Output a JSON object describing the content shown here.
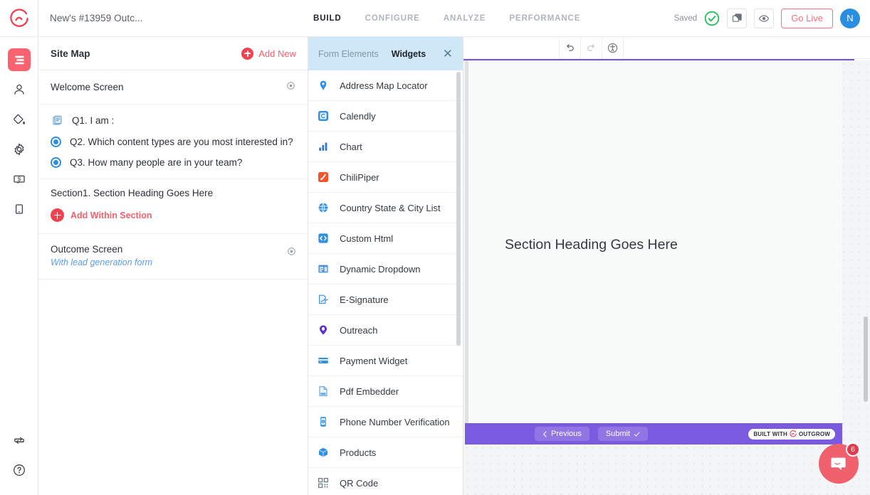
{
  "topbar": {
    "logo_icon": "outgrow-logo-icon",
    "doc_title": "New's #13959 Outc...",
    "tabs": [
      {
        "label": "BUILD",
        "active": true
      },
      {
        "label": "CONFIGURE",
        "active": false
      },
      {
        "label": "ANALYZE",
        "active": false
      },
      {
        "label": "PERFORMANCE",
        "active": false
      }
    ],
    "saved_label": "Saved",
    "saved_icon": "check-circle-icon",
    "clone_icon": "copy-icon",
    "preview_icon": "eye-icon",
    "go_live_label": "Go Live",
    "avatar_initial": "N",
    "accent_red": "#f4414f",
    "avatar_blue": "#2a8fe0",
    "go_live_border": "#f9707f"
  },
  "rail": {
    "items": [
      {
        "icon": "layout-layers-icon",
        "active": true
      },
      {
        "icon": "user-icon",
        "active": false
      },
      {
        "icon": "paint-bucket-icon",
        "active": false
      },
      {
        "icon": "gear-icon",
        "active": false
      },
      {
        "icon": "dollar-tag-icon",
        "active": false
      },
      {
        "icon": "mobile-device-icon",
        "active": false
      }
    ],
    "bottom_items": [
      {
        "icon": "sync-icon"
      },
      {
        "icon": "help-circle-icon"
      }
    ]
  },
  "sitemap": {
    "title": "Site Map",
    "add_new_label": "Add New",
    "add_new_icon": "plus-circle-icon",
    "welcome_screen": {
      "label": "Welcome Screen",
      "eye_icon": "eye-icon"
    },
    "questions": [
      {
        "label": "Q1. I am :",
        "icon": "form-list-icon"
      },
      {
        "label": "Q2. Which content types are you most interested in?",
        "icon": "radio-selected-icon"
      },
      {
        "label": "Q3. How many people are in your team?",
        "icon": "radio-selected-icon"
      }
    ],
    "section": {
      "title": "Section1. Section Heading Goes Here",
      "add_label": "Add Within Section",
      "add_icon": "plus-circle-icon"
    },
    "outcome": {
      "title": "Outcome Screen",
      "subtitle": "With lead generation form",
      "eye_icon": "eye-icon"
    }
  },
  "widgets_panel": {
    "tabs": [
      {
        "label": "Form Elements",
        "active": false
      },
      {
        "label": "Widgets",
        "active": true
      }
    ],
    "close_icon": "close-icon",
    "header_bg": "#cfe7f7",
    "items": [
      {
        "label": "Address Map Locator",
        "icon": "map-pin-icon",
        "color": "#2f8fe0"
      },
      {
        "label": "Calendly",
        "icon": "calendly-icon",
        "color": "#2f8fe0"
      },
      {
        "label": "Chart",
        "icon": "bar-chart-icon",
        "color": "#3b78c4"
      },
      {
        "label": "ChiliPiper",
        "icon": "chilipiper-icon",
        "color": "#f2552c"
      },
      {
        "label": "Country State & City List",
        "icon": "globe-icon",
        "color": "#2f8fe0"
      },
      {
        "label": "Custom Html",
        "icon": "code-brackets-icon",
        "color": "#2f8fe0"
      },
      {
        "label": "Dynamic Dropdown",
        "icon": "dynamic-dropdown-icon",
        "color": "#3b78c4"
      },
      {
        "label": "E-Signature",
        "icon": "signature-icon",
        "color": "#4a90d9"
      },
      {
        "label": "Outreach",
        "icon": "outreach-icon",
        "color": "#5a30d0"
      },
      {
        "label": "Payment Widget",
        "icon": "credit-card-icon",
        "color": "#2f8fe0"
      },
      {
        "label": "Pdf Embedder",
        "icon": "pdf-file-icon",
        "color": "#6aa9e0"
      },
      {
        "label": "Phone Number Verification",
        "icon": "phone-verify-icon",
        "color": "#2f8fe0"
      },
      {
        "label": "Products",
        "icon": "cube-box-icon",
        "color": "#2f8fe0"
      },
      {
        "label": "QR Code",
        "icon": "qr-code-icon",
        "color": "#6e7a88"
      }
    ]
  },
  "canvas": {
    "toolbar": {
      "undo_icon": "undo-icon",
      "redo_icon": "redo-icon",
      "accessibility_icon": "accessibility-icon"
    },
    "rule_color": "#7b52dd",
    "section_heading": "Section Heading Goes Here",
    "footer": {
      "bg": "#7a5adf",
      "previous_label": "Previous",
      "previous_icon": "chevron-left-icon",
      "submit_label": "Submit",
      "submit_icon": "check-icon",
      "badge_prefix": "BUILT WITH",
      "badge_brand": "OUTGROW",
      "badge_icon": "outgrow-logo-icon"
    }
  },
  "chat": {
    "icon": "chat-bubble-icon",
    "badge_count": "6",
    "bg": "#f1616d"
  }
}
